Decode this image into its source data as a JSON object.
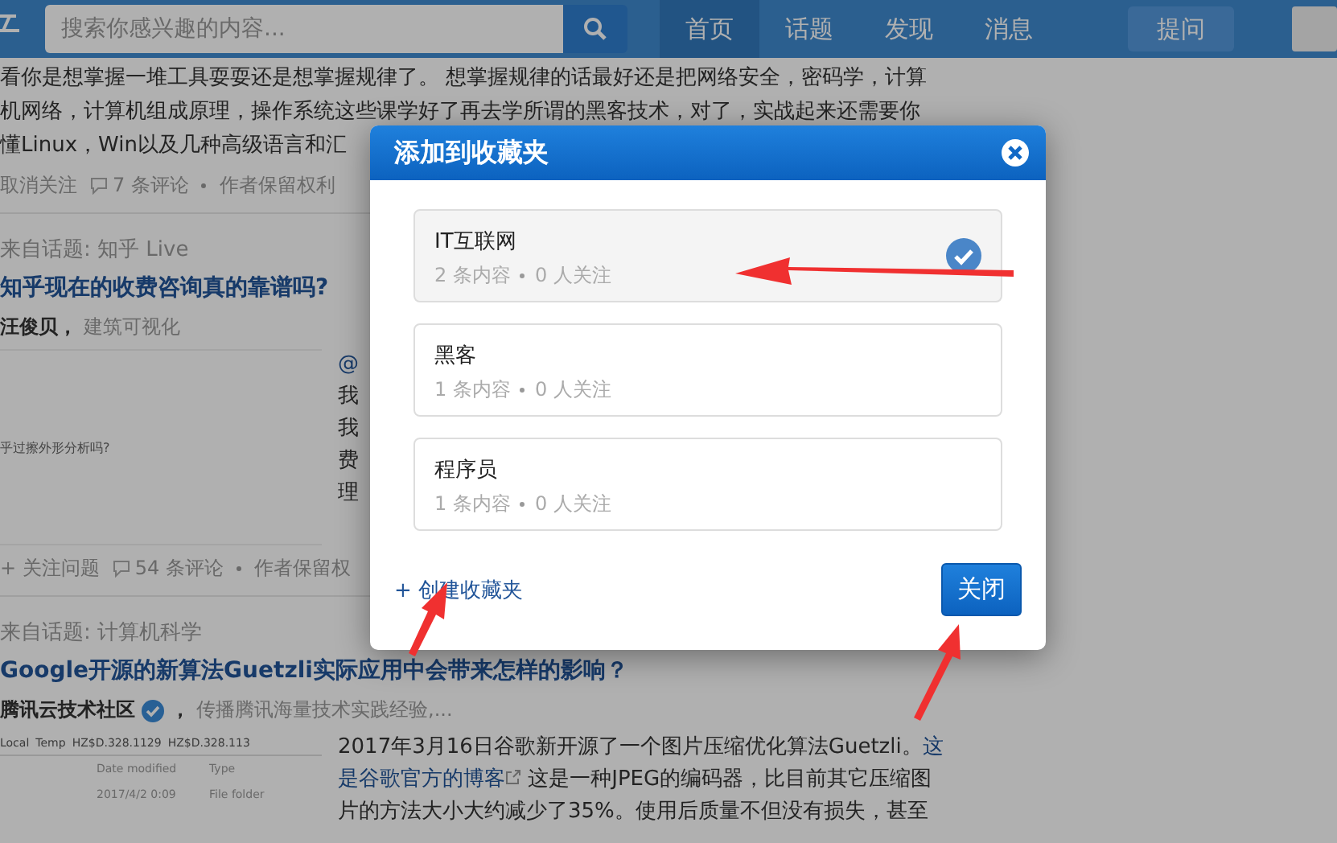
{
  "header": {
    "search": {
      "placeholder": "搜索你感兴趣的内容..."
    },
    "nav": [
      {
        "label": "首页",
        "selected": true
      },
      {
        "label": "话题",
        "selected": false
      },
      {
        "label": "发现",
        "selected": false
      },
      {
        "label": "消息",
        "selected": false
      }
    ],
    "ask_button": "提问"
  },
  "feed": {
    "first": {
      "lines": [
        "看你是想掌握一堆工具耍耍还是想掌握规律了。 想掌握规律的话最好还是把网络安全，密码学，计算",
        "机网络，计算机组成原理，操作系统这些课学好了再去学所谓的黑客技术，对了，实战起来还需要你",
        "懂Linux，Win以及几种高级语言和汇"
      ],
      "actions": [
        {
          "kind": "follow",
          "label": "取消关注"
        },
        {
          "kind": "comments",
          "label": "7 条评论"
        },
        {
          "kind": "rights",
          "label": "作者保留权利"
        }
      ]
    },
    "second": {
      "topic": "来自话题: 知乎 Live",
      "title": "知乎现在的收费咨询真的靠谱吗?",
      "author": "汪俊贝，",
      "bio": "建筑可视化",
      "thumb_caption": "乎过擦外形分析吗?",
      "mention": "@",
      "lines": [
        "我",
        "我",
        "费",
        "理"
      ],
      "actions": [
        {
          "kind": "follow",
          "label": "+ 关注问题"
        },
        {
          "kind": "comments",
          "label": "54 条评论"
        },
        {
          "kind": "rights",
          "label": "作者保留权"
        }
      ]
    },
    "third": {
      "topic": "来自话题: 计算机科学",
      "title": "Google开源的新算法Guetzli实际应用中会带来怎样的影响？",
      "author": "腾讯云技术社区",
      "verified": true,
      "comma": "，",
      "bio": "传播腾讯海量技术实践经验,...",
      "explorer": {
        "breadcrumb": [
          "Local",
          "Temp",
          "HZ$D.328.1129",
          "HZ$D.328.113"
        ],
        "columns": [
          "Date modified",
          "Type"
        ],
        "row": [
          "2017/4/2 0:09",
          "File folder"
        ]
      },
      "lines": [
        [
          {
            "text": "2017年3月16日谷歌新开源了一个图片压缩优化算法Guetzli。",
            "link": false
          },
          {
            "text": "这",
            "link": true
          }
        ],
        [
          {
            "text": "是谷歌官方的博客",
            "link": true,
            "external": true
          },
          {
            "text": " 这是一种JPEG的编码器，比目前其它压缩图",
            "link": false
          }
        ],
        [
          {
            "text": "片的方法大小大约减少了35%。使用后质量不但没有损失，甚至",
            "link": false
          }
        ]
      ]
    }
  },
  "dialog": {
    "title": "添加到收藏夹",
    "folders": [
      {
        "name": "IT互联网",
        "count": "2 条内容",
        "followers": "0 人关注",
        "selected": true
      },
      {
        "name": "黑客",
        "count": "1 条内容",
        "followers": "0 人关注",
        "selected": false
      },
      {
        "name": "程序员",
        "count": "1 条内容",
        "followers": "0 人关注",
        "selected": false
      }
    ],
    "create_link": "+ 创建收藏夹",
    "close_button": "关闭"
  }
}
